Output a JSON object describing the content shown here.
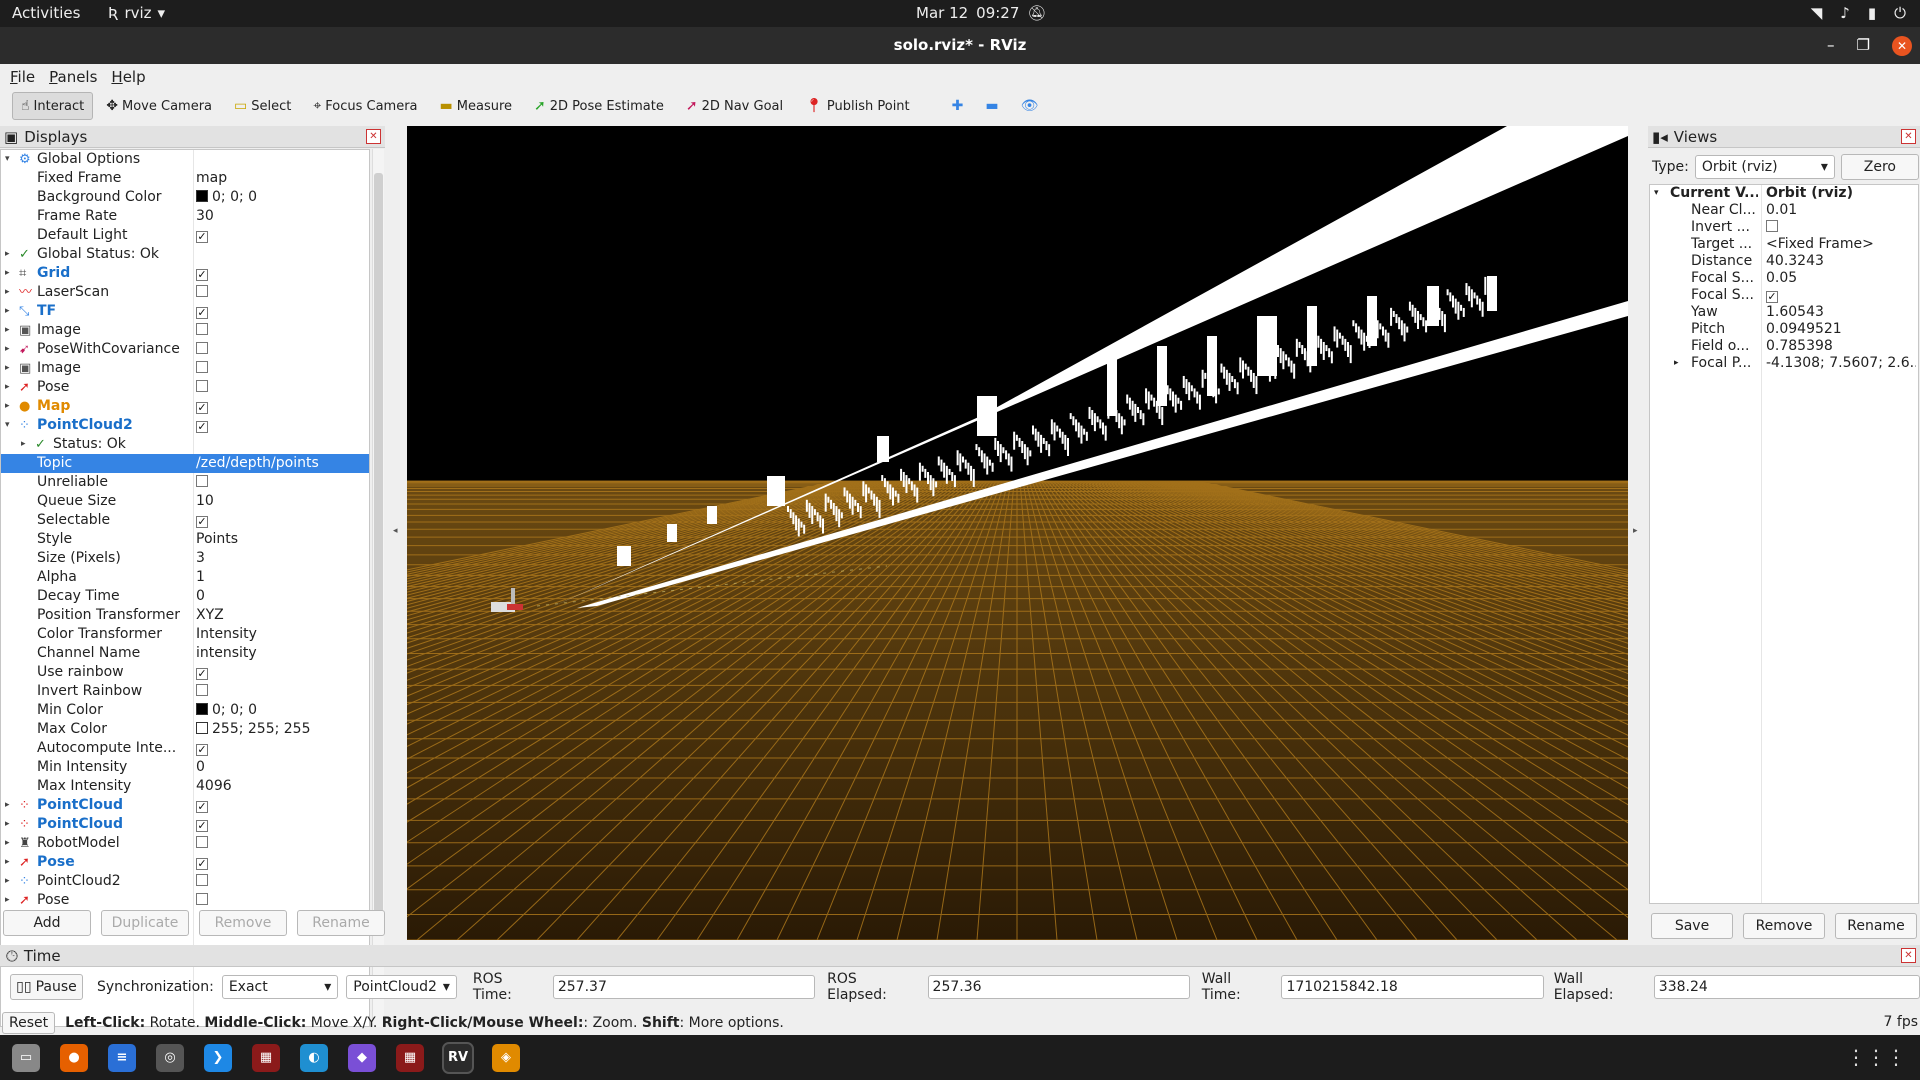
{
  "topbar": {
    "activities": "Activities",
    "app_name": "rviz",
    "date": "Mar 12",
    "time": "09:27"
  },
  "window": {
    "title": "solo.rviz* - RViz"
  },
  "menu": {
    "file": "File",
    "panels": "Panels",
    "help": "Help"
  },
  "toolbar": {
    "interact": "Interact",
    "move_camera": "Move Camera",
    "select": "Select",
    "focus_camera": "Focus Camera",
    "measure": "Measure",
    "pose_estimate": "2D Pose Estimate",
    "nav_goal": "2D Nav Goal",
    "publish_point": "Publish Point"
  },
  "displays": {
    "title": "Displays",
    "rows": [
      {
        "name": "Global Options",
        "val": "",
        "indent": 0,
        "arrow": "▾",
        "icon": "gear-icon",
        "glyph": "⚙",
        "color": "#3584e4"
      },
      {
        "name": "Fixed Frame",
        "val": "map",
        "indent": 1
      },
      {
        "name": "Background Color",
        "val": "0; 0; 0",
        "indent": 1,
        "swatch": "#000000"
      },
      {
        "name": "Frame Rate",
        "val": "30",
        "indent": 1
      },
      {
        "name": "Default Light",
        "val": "",
        "indent": 1,
        "check": "✓"
      },
      {
        "name": "Global Status: Ok",
        "val": "",
        "indent": 0,
        "arrow": "▸",
        "icon": "check-icon",
        "glyph": "✓",
        "color": "#2a8a2a"
      },
      {
        "name": "Grid",
        "val": "",
        "indent": 0,
        "arrow": "▸",
        "icon": "grid-icon",
        "glyph": "⌗",
        "color": "#444",
        "style": "blue",
        "check": "✓"
      },
      {
        "name": "LaserScan",
        "val": "",
        "indent": 0,
        "arrow": "▸",
        "icon": "laserscan-icon",
        "glyph": "〰",
        "color": "#d22",
        "check": " "
      },
      {
        "name": "TF",
        "val": "",
        "indent": 0,
        "arrow": "▸",
        "icon": "tf-icon",
        "glyph": "⤡",
        "color": "#3584e4",
        "style": "blue",
        "check": "✓"
      },
      {
        "name": "Image",
        "val": "",
        "indent": 0,
        "arrow": "▸",
        "icon": "image-icon",
        "glyph": "▣",
        "color": "#555",
        "check": " "
      },
      {
        "name": "PoseWithCovariance",
        "val": "",
        "indent": 0,
        "arrow": "▸",
        "icon": "pose-covariance-icon",
        "glyph": "➹",
        "color": "#c2185b",
        "check": " "
      },
      {
        "name": "Image",
        "val": "",
        "indent": 0,
        "arrow": "▸",
        "icon": "image-icon",
        "glyph": "▣",
        "color": "#555",
        "check": " "
      },
      {
        "name": "Pose",
        "val": "",
        "indent": 0,
        "arrow": "▸",
        "icon": "pose-icon",
        "glyph": "➚",
        "color": "#d22",
        "check": " "
      },
      {
        "name": "Map",
        "val": "",
        "indent": 0,
        "arrow": "▸",
        "icon": "warning-icon",
        "glyph": "●",
        "color": "#e08a00",
        "style": "orange",
        "check": "✓"
      },
      {
        "name": "PointCloud2",
        "val": "",
        "indent": 0,
        "arrow": "▾",
        "icon": "pointcloud-icon",
        "glyph": "⁘",
        "color": "#3584e4",
        "style": "blue",
        "check": "✓"
      },
      {
        "name": "Status: Ok",
        "val": "",
        "indent": 1,
        "arrow": "▸",
        "icon": "check-icon",
        "glyph": "✓",
        "color": "#2a8a2a"
      },
      {
        "name": "Topic",
        "val": "/zed/depth/points",
        "indent": 1,
        "selected": true
      },
      {
        "name": "Unreliable",
        "val": "",
        "indent": 1,
        "check": " "
      },
      {
        "name": "Queue Size",
        "val": "10",
        "indent": 1
      },
      {
        "name": "Selectable",
        "val": "",
        "indent": 1,
        "check": "✓"
      },
      {
        "name": "Style",
        "val": "Points",
        "indent": 1
      },
      {
        "name": "Size (Pixels)",
        "val": "3",
        "indent": 1
      },
      {
        "name": "Alpha",
        "val": "1",
        "indent": 1
      },
      {
        "name": "Decay Time",
        "val": "0",
        "indent": 1
      },
      {
        "name": "Position Transformer",
        "val": "XYZ",
        "indent": 1
      },
      {
        "name": "Color Transformer",
        "val": "Intensity",
        "indent": 1
      },
      {
        "name": "Channel Name",
        "val": "intensity",
        "indent": 1
      },
      {
        "name": "Use rainbow",
        "val": "",
        "indent": 1,
        "check": "✓"
      },
      {
        "name": "Invert Rainbow",
        "val": "",
        "indent": 1,
        "check": " "
      },
      {
        "name": "Min Color",
        "val": "0; 0; 0",
        "indent": 1,
        "swatch": "#000000"
      },
      {
        "name": "Max Color",
        "val": "255; 255; 255",
        "indent": 1,
        "swatch": "#ffffff"
      },
      {
        "name": "Autocompute Inte...",
        "val": "",
        "indent": 1,
        "check": "✓"
      },
      {
        "name": "Min Intensity",
        "val": "0",
        "indent": 1
      },
      {
        "name": "Max Intensity",
        "val": "4096",
        "indent": 1
      },
      {
        "name": "PointCloud",
        "val": "",
        "indent": 0,
        "arrow": "▸",
        "icon": "pointcloud-icon",
        "glyph": "⁘",
        "color": "#d22",
        "style": "blue",
        "check": "✓"
      },
      {
        "name": "PointCloud",
        "val": "",
        "indent": 0,
        "arrow": "▸",
        "icon": "pointcloud-icon",
        "glyph": "⁘",
        "color": "#d22",
        "style": "blue",
        "check": "✓"
      },
      {
        "name": "RobotModel",
        "val": "",
        "indent": 0,
        "arrow": "▸",
        "icon": "robot-icon",
        "glyph": "♜",
        "color": "#444",
        "check": " "
      },
      {
        "name": "Pose",
        "val": "",
        "indent": 0,
        "arrow": "▸",
        "icon": "pose-icon",
        "glyph": "➚",
        "color": "#d22",
        "style": "blue",
        "check": "✓"
      },
      {
        "name": "PointCloud2",
        "val": "",
        "indent": 0,
        "arrow": "▸",
        "icon": "pointcloud-icon",
        "glyph": "⁘",
        "color": "#3584e4",
        "check": " "
      },
      {
        "name": "Pose",
        "val": "",
        "indent": 0,
        "arrow": "▸",
        "icon": "pose-icon",
        "glyph": "➚",
        "color": "#d22",
        "check": " "
      }
    ],
    "buttons": {
      "add": "Add",
      "duplicate": "Duplicate",
      "remove": "Remove",
      "rename": "Rename"
    }
  },
  "views": {
    "title": "Views",
    "type_label": "Type:",
    "type_value": "Orbit (rviz)",
    "zero": "Zero",
    "rows": [
      {
        "name": "Current V...",
        "val": "Orbit (rviz)",
        "bold": true,
        "arrow": "▾"
      },
      {
        "name": "Near Cl...",
        "val": "0.01"
      },
      {
        "name": "Invert ...",
        "val": "",
        "check": " "
      },
      {
        "name": "Target ...",
        "val": "<Fixed Frame>"
      },
      {
        "name": "Distance",
        "val": "40.3243"
      },
      {
        "name": "Focal S...",
        "val": "0.05"
      },
      {
        "name": "Focal S...",
        "val": "",
        "check": "✓"
      },
      {
        "name": "Yaw",
        "val": "1.60543"
      },
      {
        "name": "Pitch",
        "val": "0.0949521"
      },
      {
        "name": "Field o...",
        "val": "0.785398"
      },
      {
        "name": "Focal P...",
        "val": "-4.1308; 7.5607; 2.6...",
        "arrow": "▸"
      }
    ],
    "buttons": {
      "save": "Save",
      "remove": "Remove",
      "rename": "Rename"
    }
  },
  "time": {
    "title": "Time",
    "pause": "Pause",
    "sync_label": "Synchronization:",
    "sync_value": "Exact",
    "source": "PointCloud2",
    "ros_time_label": "ROS Time:",
    "ros_time": "257.37",
    "ros_elapsed_label": "ROS Elapsed:",
    "ros_elapsed": "257.36",
    "wall_time_label": "Wall Time:",
    "wall_time": "1710215842.18",
    "wall_elapsed_label": "Wall Elapsed:",
    "wall_elapsed": "338.24"
  },
  "status": {
    "reset": "Reset",
    "k1": "Left-Click:",
    "v1": " Rotate. ",
    "k2": "Middle-Click:",
    "v2": " Move X/Y. ",
    "k3": "Right-Click/Mouse Wheel:",
    "v3": ": Zoom. ",
    "k4": "Shift",
    "v4": ": More options.",
    "fps": "7 fps"
  },
  "dock": [
    {
      "name": "files-icon",
      "glyph": "▭",
      "color": "#888"
    },
    {
      "name": "firefox-icon",
      "glyph": "●",
      "color": "#e66000"
    },
    {
      "name": "text-editor-icon",
      "glyph": "≡",
      "color": "#2a6fd6"
    },
    {
      "name": "settings-icon",
      "glyph": "◎",
      "color": "#555"
    },
    {
      "name": "vscode-icon",
      "glyph": "❯",
      "color": "#1e88e5"
    },
    {
      "name": "terminal-icon",
      "glyph": "▦",
      "color": "#8b1a1a"
    },
    {
      "name": "edge-icon",
      "glyph": "◐",
      "color": "#1f8fd1"
    },
    {
      "name": "app-icon",
      "glyph": "◆",
      "color": "#7a4fd6"
    },
    {
      "name": "terminal-icon",
      "glyph": "▦",
      "color": "#8b1a1a"
    },
    {
      "name": "rviz-icon",
      "glyph": "RV",
      "color": "#2b2b2b",
      "active": true
    },
    {
      "name": "layers-icon",
      "glyph": "◈",
      "color": "#e08a00"
    }
  ]
}
